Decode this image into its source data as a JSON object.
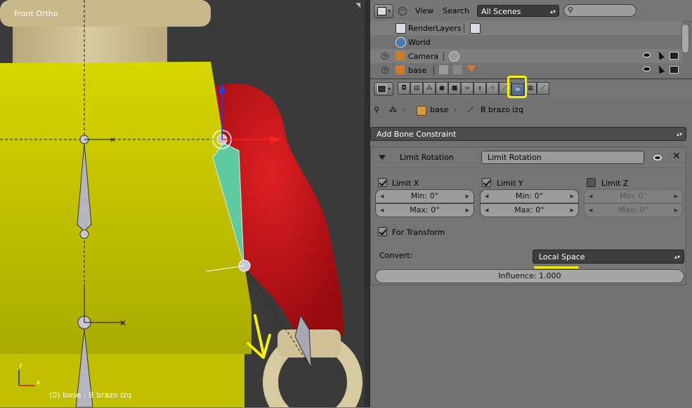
{
  "viewport": {
    "title": "Front Ortho",
    "status": "(0) base : B brazo izq",
    "axis_z": "z",
    "axis_x": "x"
  },
  "outliner": {
    "menu": {
      "view": "View",
      "search": "Search"
    },
    "scene_select": "All Scenes",
    "search_value": "",
    "rows": [
      {
        "label": "RenderLayers",
        "icon": "render-layers-icon"
      },
      {
        "label": "World",
        "icon": "world-icon"
      },
      {
        "label": "Camera",
        "icon": "camera-object-icon"
      },
      {
        "label": "base",
        "icon": "armature-object-icon"
      }
    ]
  },
  "properties": {
    "context_tabs": [
      "render",
      "render-layers",
      "scene",
      "world",
      "object",
      "constraints",
      "modifiers",
      "data",
      "bone",
      "bone-constraints",
      "texture",
      "particles"
    ],
    "active_tab": "bone-constraints",
    "breadcrumb": {
      "object": "base",
      "bone": "B brazo izq"
    },
    "add_constraint": "Add Bone Constraint",
    "constraint": {
      "type": "Limit Rotation",
      "name": "Limit Rotation",
      "limit_x": {
        "label": "Limit X",
        "checked": true,
        "min": "Min: 0°",
        "max": "Max: 0°"
      },
      "limit_y": {
        "label": "Limit Y",
        "checked": true,
        "min": "Min: 0°",
        "max": "Max: 0°"
      },
      "limit_z": {
        "label": "Limit Z",
        "checked": false,
        "min": "Min: 0°",
        "max": "Max: 0°"
      },
      "for_transform": {
        "label": "For Transform",
        "checked": true
      },
      "convert_label": "Convert:",
      "convert_value": "Local Space",
      "influence": "Influence: 1.000"
    }
  },
  "colors": {
    "highlight": "#f4f007",
    "body": "#cfcf00",
    "arm": "#c8141a",
    "active_bone": "#5fc9a0"
  }
}
